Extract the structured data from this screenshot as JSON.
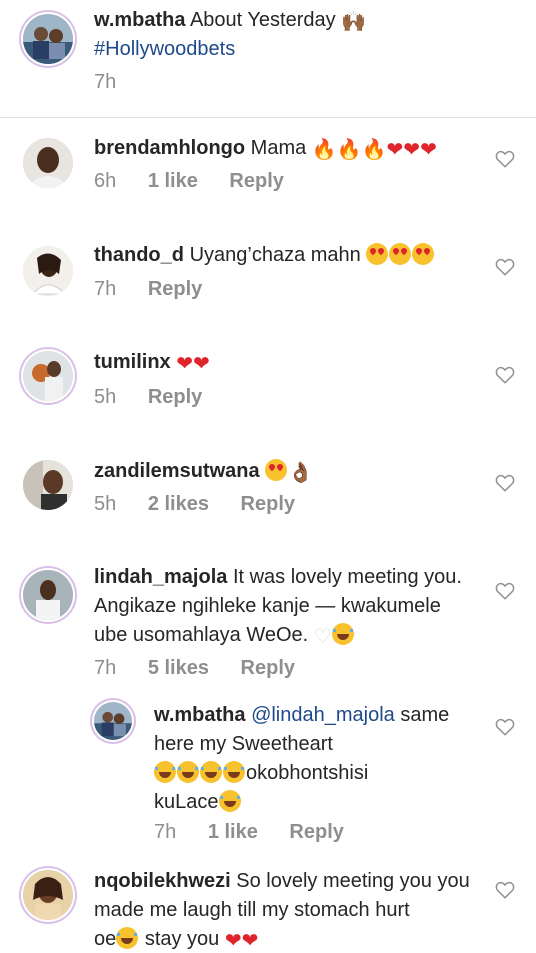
{
  "caption": {
    "username": "w.mbatha",
    "text": "About Yesterday",
    "hands_emoji": "🙌🏾",
    "hashtag": "#Hollywoodbets",
    "time": "7h"
  },
  "comments": [
    {
      "username": "brendamhlongo",
      "text": "Mama",
      "time": "6h",
      "likes": "1 like",
      "reply": "Reply"
    },
    {
      "username": "thando_d",
      "text": "Uyang’chaza mahn",
      "time": "7h",
      "reply": "Reply"
    },
    {
      "username": "tumilinx",
      "text": "",
      "time": "5h",
      "reply": "Reply"
    },
    {
      "username": "zandilemsutwana",
      "text": "",
      "time": "5h",
      "likes": "2 likes",
      "reply": "Reply"
    },
    {
      "username": "lindah_majola",
      "text_line1": "It was lovely meeting you.",
      "text_line2": "Angikaze ngihleke kanje — kwakumele",
      "text_line3": "ube usomahlaya WeOe.",
      "time": "7h",
      "likes": "5 likes",
      "reply": "Reply"
    },
    {
      "username": "w.mbatha",
      "mention": "@lindah_majola",
      "text_line1": "same",
      "text_line2": "here my Sweetheart",
      "text_line3": "okobhontshisi",
      "text_line4": "kuLace",
      "time": "7h",
      "likes": "1 like",
      "reply": "Reply"
    },
    {
      "username": "nqobilekhwezi",
      "text_line1": "So lovely meeting you you",
      "text_line2": "made me laugh till my stomach hurt",
      "text_line3a": "oe",
      "text_line3b": "stay you"
    }
  ],
  "emoji": {
    "fire": "🔥",
    "red_heart": "❤",
    "white_heart": "♡",
    "ok_hand": "👌🏾"
  },
  "icons": {
    "like": "heart-outline-icon"
  },
  "colors": {
    "text": "#262626",
    "meta": "#8e8e8e",
    "link": "#1e4a8a",
    "fire": "#ff6a00",
    "heart": "#e0242c"
  }
}
